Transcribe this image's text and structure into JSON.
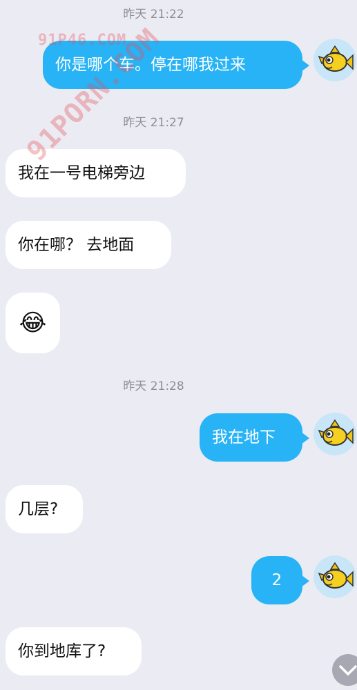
{
  "messages": [
    {
      "type": "timestamp",
      "text": "昨天 21:22"
    },
    {
      "type": "outgoing",
      "text": "你是哪个车。停在哪我过来"
    },
    {
      "type": "timestamp",
      "text": "昨天 21:27"
    },
    {
      "type": "incoming",
      "text": "我在一号电梯旁边"
    },
    {
      "type": "incoming",
      "text": "你在哪？ 去地面"
    },
    {
      "type": "incoming",
      "text": "😂"
    },
    {
      "type": "timestamp",
      "text": "昨天 21:28"
    },
    {
      "type": "outgoing",
      "text": "我在地下"
    },
    {
      "type": "incoming",
      "text": "几层?"
    },
    {
      "type": "outgoing",
      "text": "2"
    },
    {
      "type": "incoming",
      "text": "你到地库了?"
    }
  ],
  "watermarks": [
    "91P46.COM",
    "91PORN.COM"
  ],
  "colors": {
    "background": "#ebebf3",
    "outgoing_bubble": "#27b3f5",
    "incoming_bubble": "#ffffff",
    "timestamp_text": "#8e8e93"
  },
  "icons": {
    "avatar": "yellow-fish-avatar-icon",
    "scroll_down": "chevron-down-icon"
  }
}
